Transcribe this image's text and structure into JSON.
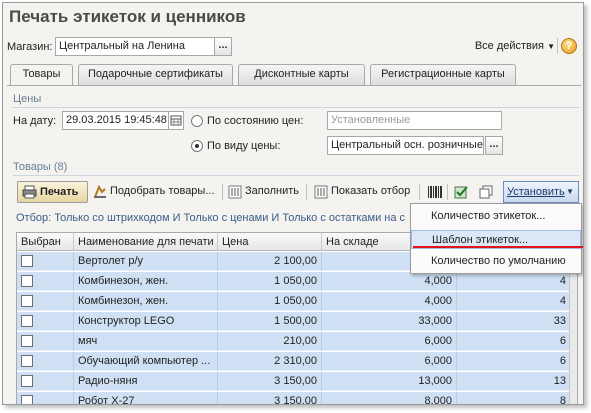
{
  "window": {
    "title": "Печать этикеток и ценников"
  },
  "store": {
    "label": "Магазин:",
    "value": "Центральный на Ленина",
    "select_btn": "..."
  },
  "header_actions": {
    "all_actions": "Все действия",
    "help": "?"
  },
  "tabs": [
    {
      "label": "Товары",
      "active": true
    },
    {
      "label": "Подарочные сертификаты",
      "active": false
    },
    {
      "label": "Дисконтные карты",
      "active": false
    },
    {
      "label": "Регистрационные карты",
      "active": false
    }
  ],
  "prices": {
    "section_title": "Цены",
    "date_label": "На дату:",
    "date_value": "29.03.2015 19:45:48",
    "by_state_label": "По состоянию цен:",
    "by_state_value": "Установленные",
    "by_type_label": "По виду цены:",
    "by_type_value": "Центральный осн. розничные",
    "select_btn": "..."
  },
  "goods": {
    "section_title": "Товары (8)"
  },
  "toolbar": {
    "print": "Печать",
    "pick_goods": "Подобрать товары...",
    "fill": "Заполнить",
    "show_filter": "Показать отбор",
    "set": "Установить"
  },
  "filter_text": "Отбор:  Только со штрихкодом И Только с ценами И Только с остатками на с",
  "set_menu": {
    "items": [
      {
        "label": "Количество этикеток...",
        "highlighted": false
      },
      {
        "label": "Шаблон этикеток...",
        "highlighted": true
      },
      {
        "label": "Количество по умолчанию",
        "highlighted": false
      }
    ]
  },
  "table": {
    "columns": [
      "Выбран",
      "Наименование для печати",
      "Цена",
      "На складе",
      ""
    ],
    "rows": [
      {
        "selected": false,
        "name": "Вертолет р/у",
        "price": "2 100,00",
        "stock": "",
        "qty": ""
      },
      {
        "selected": false,
        "name": "Комбинезон, жен.",
        "price": "1 050,00",
        "stock": "4,000",
        "qty": "4"
      },
      {
        "selected": false,
        "name": "Комбинезон, жен.",
        "price": "1 050,00",
        "stock": "4,000",
        "qty": "4"
      },
      {
        "selected": false,
        "name": "Конструктор LEGO",
        "price": "1 500,00",
        "stock": "33,000",
        "qty": "33"
      },
      {
        "selected": false,
        "name": "мяч",
        "price": "210,00",
        "stock": "6,000",
        "qty": "6"
      },
      {
        "selected": false,
        "name": "Обучающий компьютер ...",
        "price": "2 310,00",
        "stock": "6,000",
        "qty": "6"
      },
      {
        "selected": false,
        "name": "Радио-няня",
        "price": "3 150,00",
        "stock": "13,000",
        "qty": "13"
      },
      {
        "selected": false,
        "name": "Робот Х-27",
        "price": "3 150,00",
        "stock": "8,000",
        "qty": "8"
      }
    ]
  },
  "colors": {
    "highlight_red": "#e0141a",
    "row_selected_bg": "#cfe0f4",
    "section_text": "#6a7f98"
  }
}
